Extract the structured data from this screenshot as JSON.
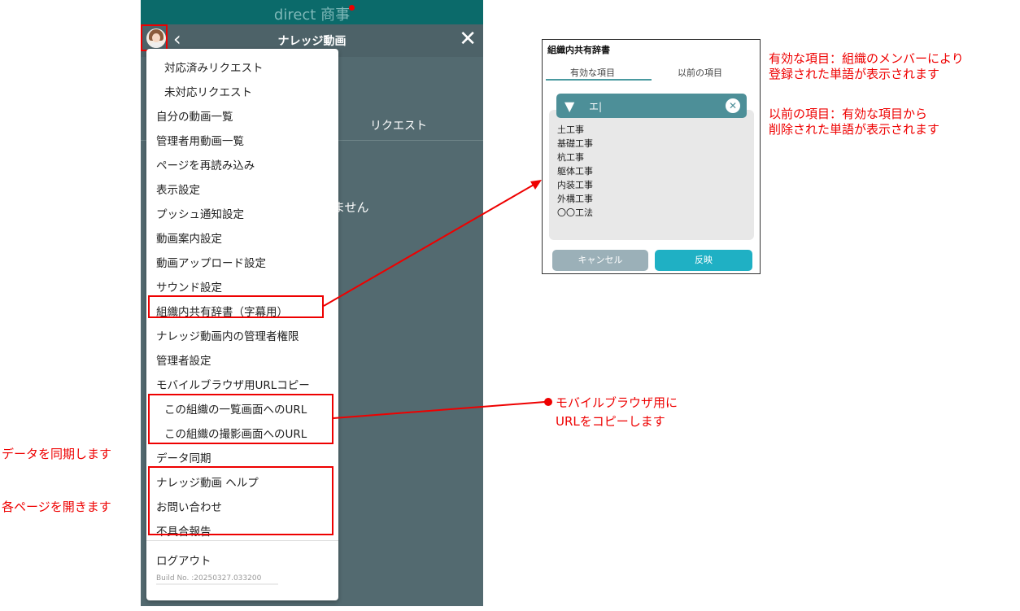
{
  "phone": {
    "brand": "direct 商事",
    "title": "ナレッジ動画",
    "back_icon": "chevron-left-icon",
    "close_icon": "close-icon",
    "tab_request": "リクエスト",
    "bg_text": "ません"
  },
  "menu": {
    "items": [
      "対応済みリクエスト",
      "未対応リクエスト",
      "自分の動画一覧",
      "管理者用動画一覧",
      "ページを再読み込み",
      "表示設定",
      "プッシュ通知設定",
      "動画案内設定",
      "動画アップロード設定",
      "サウンド設定",
      "組織内共有辞書（字幕用）",
      "ナレッジ動画内の管理者権限",
      "管理者設定",
      "モバイルブラウザ用URLコピー",
      "この組織の一覧画面へのURL",
      "この組織の撮影画面へのURL",
      "データ同期",
      "ナレッジ動画 ヘルプ",
      "お問い合わせ",
      "不具合報告",
      "ログアウト"
    ],
    "build": "Build No. :20250327.033200"
  },
  "dialog": {
    "title": "組織内共有辞書",
    "tab_active": "有効な項目",
    "tab_previous": "以前の項目",
    "filter_text": "エ|",
    "words": [
      "土工事",
      "基礎工事",
      "杭工事",
      "躯体工事",
      "内装工事",
      "外構工事",
      "〇〇工法"
    ],
    "cancel": "キャンセル",
    "apply": "反映"
  },
  "annotations": {
    "active_line1": "有効な項目：組織のメンバーにより",
    "active_line2": "登録された単語が表示されます",
    "previous_line1": "以前の項目：有効な項目から",
    "previous_line2": "削除された単語が表示されます",
    "url_line1": "モバイルブラウザ用に",
    "url_line2": "URLをコピーします",
    "sync": "データを同期します",
    "pages": "各ページを開きます"
  },
  "colors": {
    "accent_red": "#ee0000",
    "teal_header": "#0b6a6a",
    "filter_teal": "#4d8f98",
    "apply_button": "#1fb0c4"
  }
}
